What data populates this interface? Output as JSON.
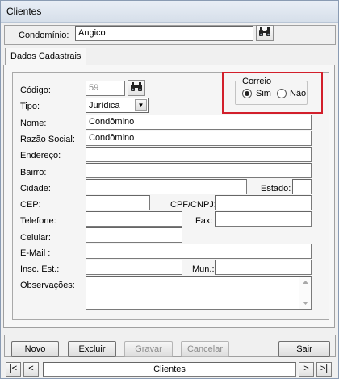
{
  "window": {
    "title": "Clientes"
  },
  "top": {
    "condominio_label": "Condomínio:",
    "condominio_value": "Angico"
  },
  "tab": {
    "label": "Dados Cadastrais"
  },
  "form": {
    "codigo_label": "Código:",
    "codigo_value": "59",
    "tipo_label": "Tipo:",
    "tipo_value": "Jurídica",
    "nome_label": "Nome:",
    "nome_value": "Condômino",
    "razao_label": "Razão Social:",
    "razao_value": "Condômino",
    "endereco_label": "Endereço:",
    "bairro_label": "Bairro:",
    "cidade_label": "Cidade:",
    "estado_label": "Estado:",
    "cep_label": "CEP:",
    "cpf_label": "CPF/CNPJ:",
    "telefone_label": "Telefone:",
    "fax_label": "Fax:",
    "celular_label": "Celular:",
    "email_label": "E-Mail :",
    "insc_label": "Insc. Est.:",
    "mun_label": "Mun.:",
    "obs_label": "Observações:"
  },
  "correio": {
    "title": "Correio",
    "sim": "Sim",
    "nao": "Não",
    "selected": "Sim"
  },
  "actions": {
    "novo": "Novo",
    "excluir": "Excluir",
    "gravar": "Gravar",
    "cancelar": "Cancelar",
    "sair": "Sair"
  },
  "navigator": {
    "first": "|<",
    "prev": "<",
    "label": "Clientes",
    "next": ">",
    "last": ">|"
  },
  "icons": {
    "search": "binoculars-icon",
    "dropdown": "chevron-down-icon"
  },
  "colors": {
    "highlight_border": "#d21f2b"
  }
}
